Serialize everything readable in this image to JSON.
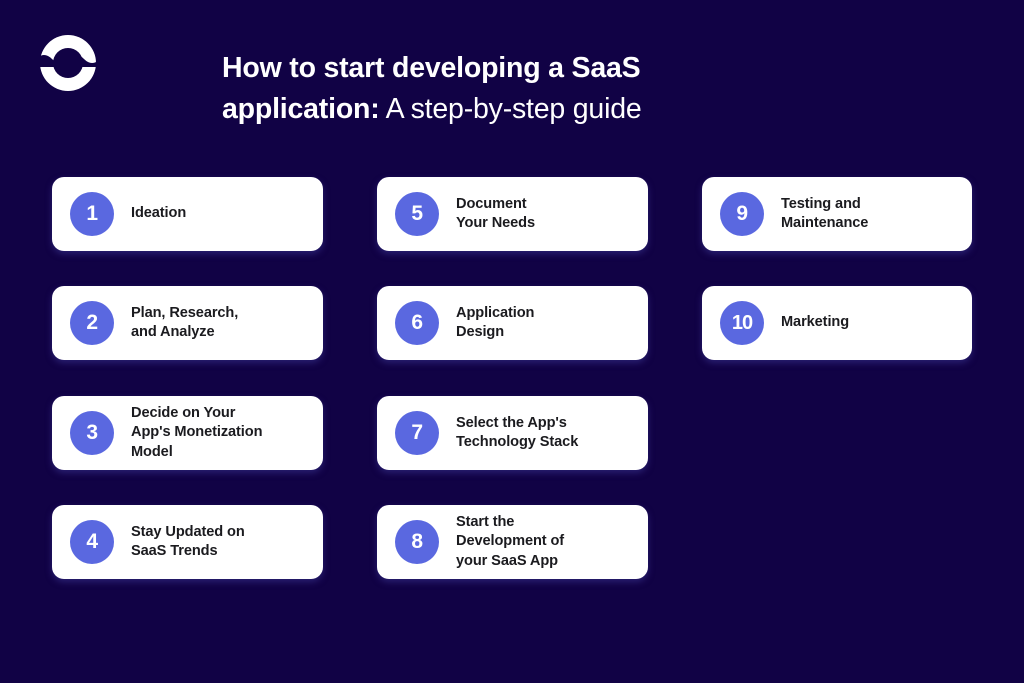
{
  "brand": {
    "logo_icon": "circle-wave-logo-icon"
  },
  "header": {
    "title_bold_part": "How to start developing a SaaS",
    "title_bold_part_2": "application:",
    "title_light_part": " A step-by-step guide"
  },
  "colors": {
    "background": "#110245",
    "card_background": "#FFFFFF",
    "badge": "#5A68E0",
    "title_text": "#FFFFFF",
    "card_text": "#1B1B1F"
  },
  "steps": [
    {
      "number": "1",
      "label": "Ideation"
    },
    {
      "number": "2",
      "label": "Plan, Research,\nand Analyze"
    },
    {
      "number": "3",
      "label": "Decide on Your\nApp's Monetization\nModel"
    },
    {
      "number": "4",
      "label": "Stay Updated on\nSaaS Trends"
    },
    {
      "number": "5",
      "label": "Document\nYour Needs"
    },
    {
      "number": "6",
      "label": "Application\nDesign"
    },
    {
      "number": "7",
      "label": "Select the App's\nTechnology Stack"
    },
    {
      "number": "8",
      "label": "Start the\nDevelopment of\nyour SaaS App"
    },
    {
      "number": "9",
      "label": "Testing and\nMaintenance"
    },
    {
      "number": "10",
      "label": "Marketing"
    }
  ]
}
